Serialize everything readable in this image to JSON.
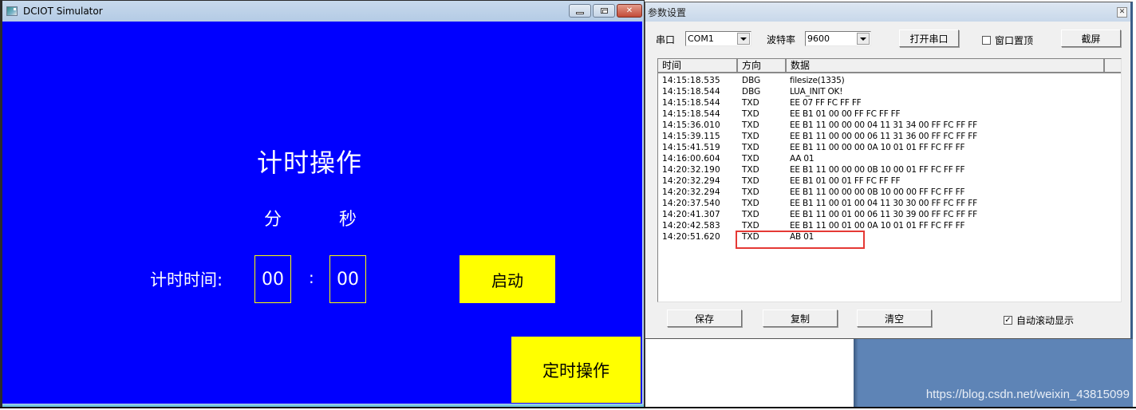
{
  "simulator": {
    "title": "DCIOT Simulator",
    "screen": {
      "title": "计时操作",
      "minutes_label": "分",
      "seconds_label": "秒",
      "time_label": "计时时间:",
      "minutes_value": "00",
      "separator": ":",
      "seconds_value": "00",
      "start_button": "启动",
      "timer_op_button": "定时操作"
    },
    "colors": {
      "background": "#0000ff",
      "button": "#ffff00",
      "text": "#ffffff"
    }
  },
  "params": {
    "title": "参数设置",
    "port_label": "串口",
    "port_value": "COM1",
    "baud_label": "波特率",
    "baud_value": "9600",
    "open_port_button": "打开串口",
    "topmost_label": "窗口置顶",
    "topmost_checked": false,
    "screenshot_button": "截屏",
    "log": {
      "columns": [
        "时间",
        "方向",
        "数据"
      ],
      "rows": [
        {
          "time": "14:15:18.535",
          "dir": "DBG",
          "data": "filesize(1335)"
        },
        {
          "time": "14:15:18.544",
          "dir": "DBG",
          "data": "LUA_INIT OK!"
        },
        {
          "time": "14:15:18.544",
          "dir": "TXD",
          "data": "EE 07 FF FC FF FF"
        },
        {
          "time": "14:15:18.544",
          "dir": "TXD",
          "data": "EE B1 01 00 00 FF FC FF FF"
        },
        {
          "time": "14:15:36.010",
          "dir": "TXD",
          "data": "EE B1 11 00 00 00 04 11 31 34 00 FF FC FF FF"
        },
        {
          "time": "14:15:39.115",
          "dir": "TXD",
          "data": "EE B1 11 00 00 00 06 11 31 36 00 FF FC FF FF"
        },
        {
          "time": "14:15:41.519",
          "dir": "TXD",
          "data": "EE B1 11 00 00 00 0A 10 01 01 FF FC FF FF"
        },
        {
          "time": "14:16:00.604",
          "dir": "TXD",
          "data": "AA 01"
        },
        {
          "time": "14:20:32.190",
          "dir": "TXD",
          "data": "EE B1 11 00 00 00 0B 10 00 01 FF FC FF FF"
        },
        {
          "time": "14:20:32.294",
          "dir": "TXD",
          "data": "EE B1 01 00 01 FF FC FF FF"
        },
        {
          "time": "14:20:32.294",
          "dir": "TXD",
          "data": "EE B1 11 00 00 00 0B 10 00 00 FF FC FF FF"
        },
        {
          "time": "14:20:37.540",
          "dir": "TXD",
          "data": "EE B1 11 00 01 00 04 11 30 30 00 FF FC FF FF"
        },
        {
          "time": "14:20:41.307",
          "dir": "TXD",
          "data": "EE B1 11 00 01 00 06 11 30 39 00 FF FC FF FF"
        },
        {
          "time": "14:20:42.583",
          "dir": "TXD",
          "data": "EE B1 11 00 01 00 0A 10 01 01 FF FC FF FF"
        },
        {
          "time": "14:20:51.620",
          "dir": "TXD",
          "data": "AB 01"
        }
      ],
      "highlighted_row": 14,
      "highlight_color": "#e53935"
    },
    "save_button": "保存",
    "copy_button": "复制",
    "clear_button": "清空",
    "autoscroll_label": "自动滚动显示",
    "autoscroll_checked": true
  },
  "watermark": "https://blog.csdn.net/weixin_43815099"
}
